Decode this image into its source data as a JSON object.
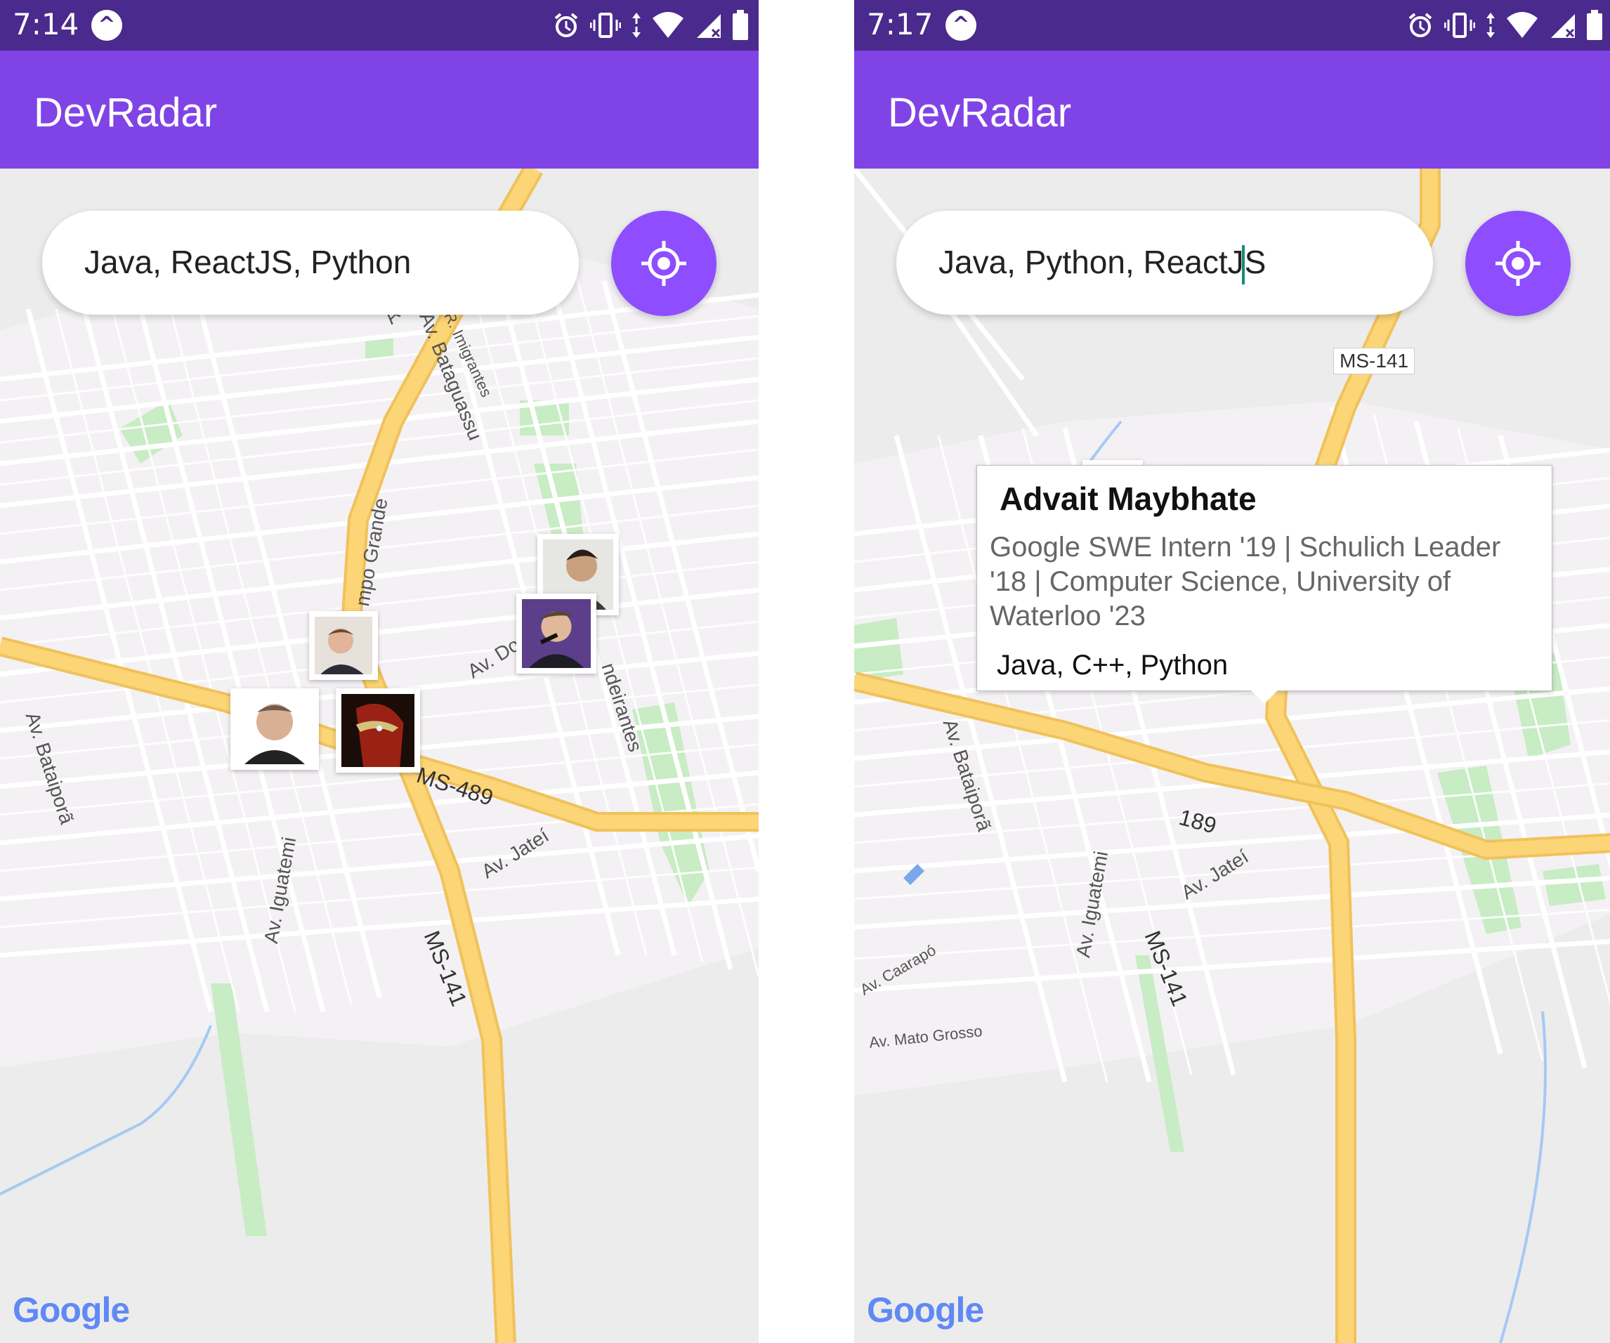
{
  "left": {
    "status": {
      "time": "7:14"
    },
    "app_title": "DevRadar",
    "search": {
      "value": "Java, ReactJS, Python"
    },
    "road_labels": {
      "brasil": "Av. Brasil",
      "imigrantes": "R. Imigrantes",
      "bataguassu": "Av. Bataguassu",
      "campo_grande": "mpo Grande",
      "av_do": "Av. Do",
      "bandeirantes": "ndeirantes",
      "ms489": "MS-489",
      "jatei": "Av. Jateí",
      "bataipora": "Av. Bataiporã",
      "iguatemi": "Av. Iguatemi",
      "ms141": "MS-141"
    }
  },
  "right": {
    "status": {
      "time": "7:17"
    },
    "app_title": "DevRadar",
    "search": {
      "value": "Java, Python, ReactJ",
      "value_after_caret": "S"
    },
    "shield": "MS-141",
    "road_labels": {
      "bataipora": "Av. Bataiporã",
      "iguatemi": "Av. Iguatemi",
      "jatei": "Av. Jateí",
      "ms141": "MS-141",
      "ms489_part": "189",
      "caarapo": "Av. Caarapó",
      "mato_grosso": "Av. Mato Grosso"
    },
    "callout": {
      "name": "Advait Maybhate",
      "bio": "Google SWE Intern '19 | Schulich Leader '18 | Computer Science, University of Waterloo '23",
      "techs": "Java, C++, Python"
    }
  },
  "google_logo": "Google",
  "colors": {
    "status_bar": "#4a2a8c",
    "app_bar": "#8044e6",
    "accent": "#8e4dff",
    "highway": "#fcd576",
    "park": "#c8ecc4"
  },
  "icons": [
    "app-notification-icon",
    "alarm-icon",
    "vibrate-icon",
    "data-arrows-icon",
    "wifi-icon",
    "signal-icon",
    "battery-icon",
    "my-location-icon"
  ]
}
